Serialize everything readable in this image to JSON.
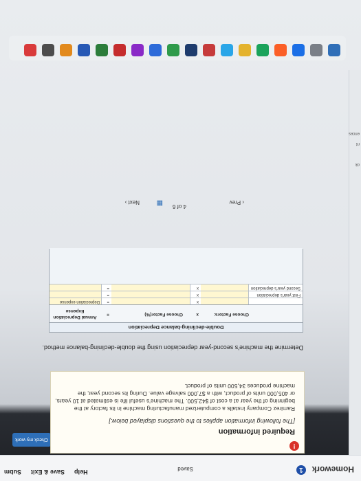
{
  "header": {
    "title": "Homework",
    "info_icon": "1",
    "status": "Saved",
    "help": "Help",
    "save_exit": "Save & Exit",
    "submit": "Subm"
  },
  "check_button": "Check my work",
  "left_strip": [
    "ok",
    "nt",
    "ences"
  ],
  "alert_icon": "!",
  "required": {
    "title": "Required information",
    "italic": "[The following information applies to the questions displayed below.]",
    "body": "Ramirez Company installs a computerized manufacturing machine in its factory at the beginning of the year at a cost of $42,500. The machine's useful life is estimated at 10 years, or 405,000 units of product, with a $7,000 salvage value. During its second year, the machine produces 34,500 units of product."
  },
  "question": "Determine the machine's second-year depreciation using the double-declining-balance method.",
  "table": {
    "title": "Double-declining-balance Depreciation",
    "headers": {
      "c1": "Choose Factors:",
      "x": "x",
      "c2": "Choose Factor(%)",
      "eq": "=",
      "c3": "Annual Depreciation Expense"
    },
    "rows": [
      {
        "label": "",
        "x": "x",
        "eq": "=",
        "value": "Depreciation expense"
      },
      {
        "label": "First year's depreciation",
        "x": "x",
        "eq": "=",
        "value": ""
      },
      {
        "label": "Second year's depreciation",
        "x": "x",
        "eq": "=",
        "value": ""
      }
    ]
  },
  "pager": {
    "prev": "Prev",
    "page_top": "4",
    "page_of": "of 6",
    "next": "Next"
  },
  "colors": {
    "primary": "#2e6fb8",
    "alert": "#d9322a",
    "input_bg": "#fff7d1"
  },
  "icons": {
    "info": "info-circle-icon",
    "alert": "alert-icon",
    "grid": "grid-icon",
    "prev": "chevron-left-icon",
    "next": "chevron-right-icon"
  }
}
